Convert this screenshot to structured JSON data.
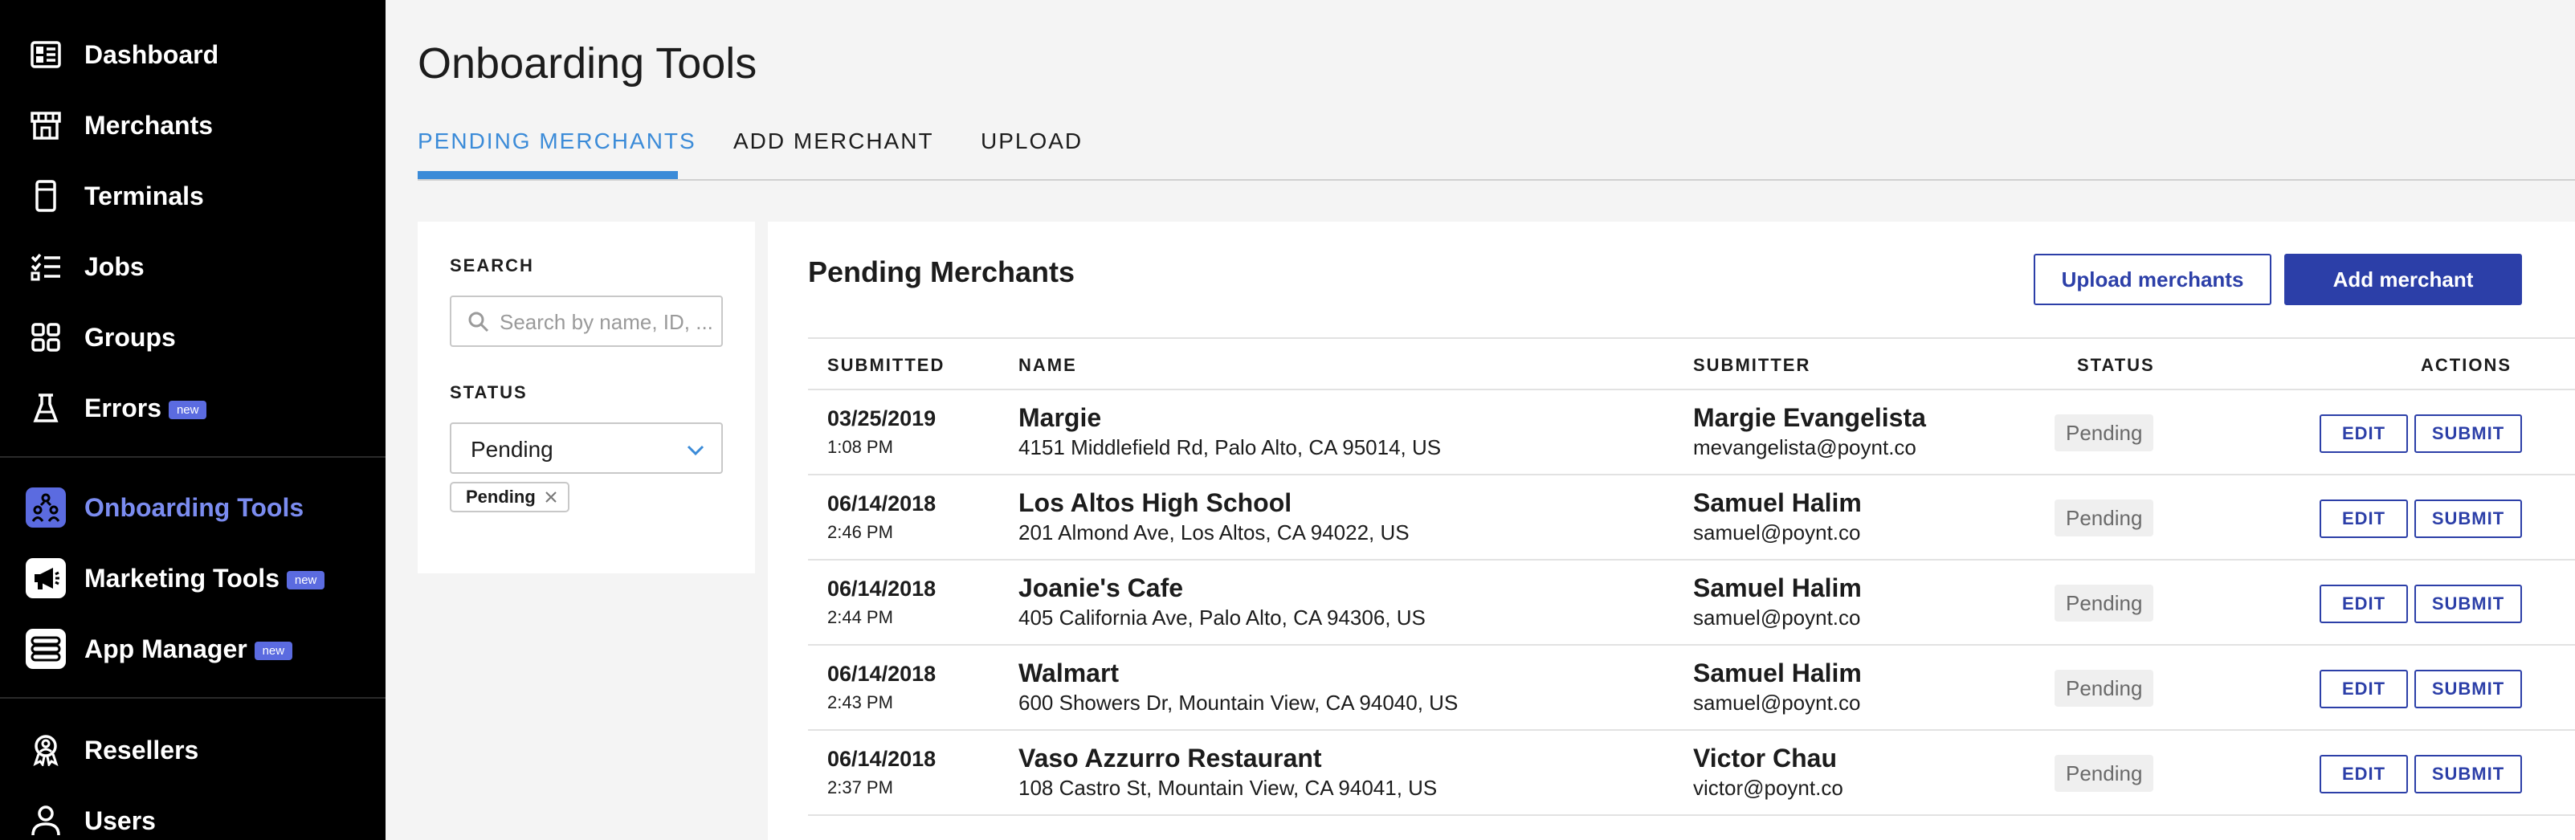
{
  "sidebar": {
    "items": [
      {
        "label": "Dashboard",
        "icon": "dashboard-icon"
      },
      {
        "label": "Merchants",
        "icon": "storefront-icon"
      },
      {
        "label": "Terminals",
        "icon": "terminal-icon"
      },
      {
        "label": "Jobs",
        "icon": "checklist-icon"
      },
      {
        "label": "Groups",
        "icon": "grid-icon"
      },
      {
        "label": "Errors",
        "icon": "flask-icon",
        "badge": "new"
      },
      {
        "label": "Onboarding Tools",
        "icon": "onboarding-icon",
        "active": true
      },
      {
        "label": "Marketing Tools",
        "icon": "megaphone-icon",
        "badge": "new"
      },
      {
        "label": "App Manager",
        "icon": "app-manager-icon",
        "badge": "new"
      },
      {
        "label": "Resellers",
        "icon": "reseller-icon"
      },
      {
        "label": "Users",
        "icon": "user-icon"
      }
    ],
    "active_color": "#7b8cf0",
    "badge_color": "#5b6be0"
  },
  "page": {
    "title": "Onboarding Tools",
    "tabs": [
      {
        "label": "PENDING MERCHANTS",
        "active": true
      },
      {
        "label": "ADD MERCHANT"
      },
      {
        "label": "UPLOAD"
      }
    ],
    "accent_color": "#3b8bd8"
  },
  "filters": {
    "search_label": "SEARCH",
    "search_placeholder": "Search by name, ID, ...",
    "status_label": "STATUS",
    "status_value": "Pending",
    "chips": [
      "Pending"
    ]
  },
  "main": {
    "title": "Pending Merchants",
    "upload_button": "Upload merchants",
    "add_button": "Add merchant",
    "primary_color": "#2c3fa8",
    "columns": [
      "SUBMITTED",
      "NAME",
      "SUBMITTER",
      "STATUS",
      "ACTIONS"
    ],
    "rows": [
      {
        "date": "03/25/2019",
        "time": "1:08 PM",
        "name": "Margie",
        "address": "4151 Middlefield Rd, Palo Alto, CA 95014, US",
        "submitter": "Margie Evangelista",
        "email": "mevangelista@poynt.co",
        "status": "Pending"
      },
      {
        "date": "06/14/2018",
        "time": "2:46 PM",
        "name": "Los Altos High School",
        "address": "201 Almond Ave, Los Altos, CA 94022, US",
        "submitter": "Samuel Halim",
        "email": "samuel@poynt.co",
        "status": "Pending"
      },
      {
        "date": "06/14/2018",
        "time": "2:44 PM",
        "name": "Joanie's Cafe",
        "address": "405 California Ave, Palo Alto, CA 94306, US",
        "submitter": "Samuel Halim",
        "email": "samuel@poynt.co",
        "status": "Pending"
      },
      {
        "date": "06/14/2018",
        "time": "2:43 PM",
        "name": "Walmart",
        "address": "600 Showers Dr, Mountain View, CA 94040, US",
        "submitter": "Samuel Halim",
        "email": "samuel@poynt.co",
        "status": "Pending"
      },
      {
        "date": "06/14/2018",
        "time": "2:37 PM",
        "name": "Vaso Azzurro Restaurant",
        "address": "108 Castro St, Mountain View, CA 94041, US",
        "submitter": "Victor Chau",
        "email": "victor@poynt.co",
        "status": "Pending"
      }
    ],
    "edit_label": "EDIT",
    "submit_label": "SUBMIT"
  }
}
